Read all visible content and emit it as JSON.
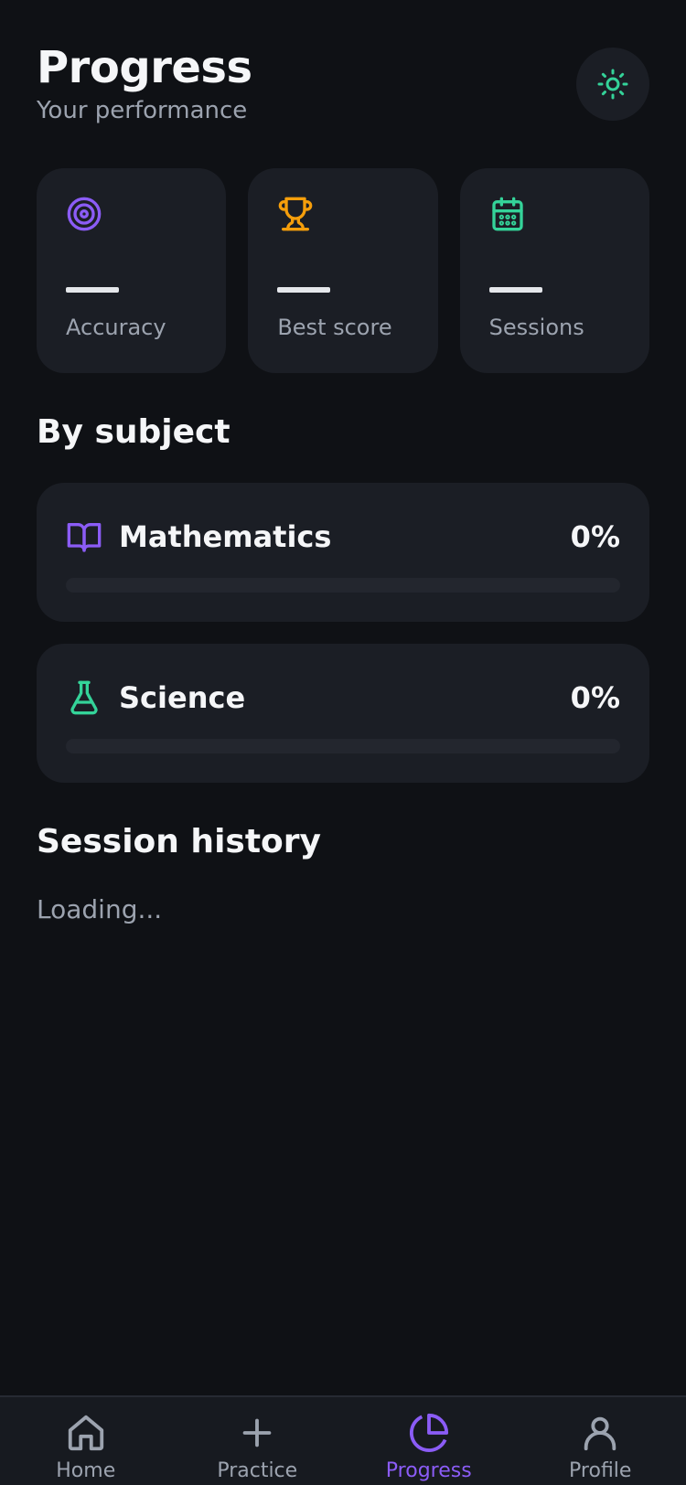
{
  "header": {
    "title": "Progress",
    "subtitle": "Your performance",
    "theme_icon": "sun-icon"
  },
  "stats": [
    {
      "label": "Accuracy",
      "value": "",
      "icon": "target-icon",
      "color": "#8b5cf6"
    },
    {
      "label": "Best score",
      "value": "",
      "icon": "trophy-icon",
      "color": "#f59e0b"
    },
    {
      "label": "Sessions",
      "value": "",
      "icon": "calendar-icon",
      "color": "#34d399"
    }
  ],
  "by_subject": {
    "title": "By subject",
    "subjects": [
      {
        "name": "Mathematics",
        "percent_label": "0%",
        "progress": 0,
        "icon": "book-icon",
        "color": "#8b5cf6"
      },
      {
        "name": "Science",
        "percent_label": "0%",
        "progress": 0,
        "icon": "flask-icon",
        "color": "#34d399"
      }
    ]
  },
  "session_history": {
    "title": "Session history",
    "status": "Loading..."
  },
  "tabbar": {
    "tabs": [
      {
        "label": "Home",
        "icon": "home-icon",
        "active": false
      },
      {
        "label": "Practice",
        "icon": "plus-icon",
        "active": false
      },
      {
        "label": "Progress",
        "icon": "pie-chart-icon",
        "active": true
      },
      {
        "label": "Profile",
        "icon": "user-icon",
        "active": false
      }
    ]
  },
  "colors": {
    "accent": "#8b5cf6",
    "background": "#0f1115",
    "card": "#1b1e25",
    "green": "#34d399",
    "amber": "#f59e0b"
  }
}
